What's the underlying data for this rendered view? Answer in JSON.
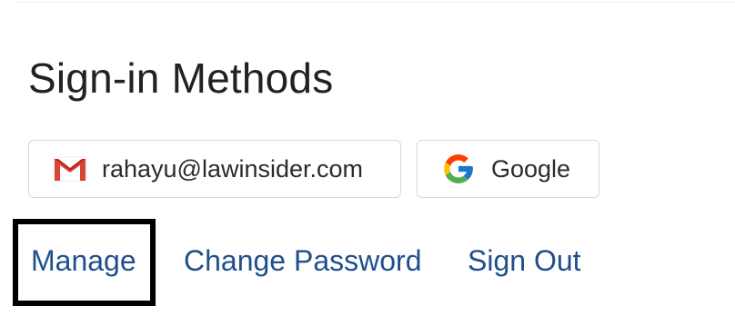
{
  "section": {
    "title": "Sign-in Methods"
  },
  "methods": [
    {
      "label": "rahayu@lawinsider.com",
      "icon": "gmail-icon"
    },
    {
      "label": "Google",
      "icon": "google-icon"
    }
  ],
  "actions": {
    "manage_label": "Manage",
    "change_password_label": "Change Password",
    "sign_out_label": "Sign Out"
  },
  "colors": {
    "title": "#222222",
    "link": "#1f4f8c",
    "chip_border": "#d9d9d9",
    "focus_outline": "#000000"
  }
}
